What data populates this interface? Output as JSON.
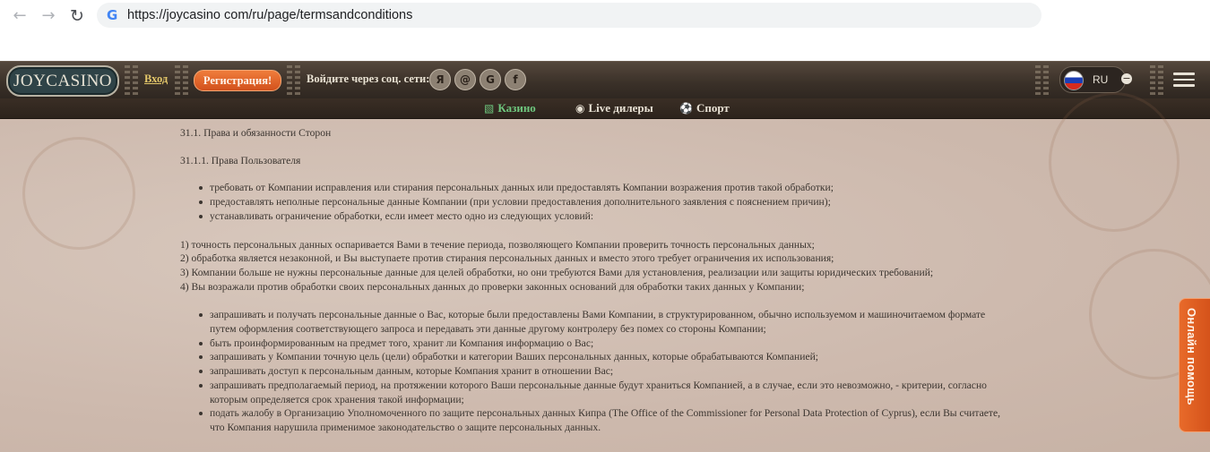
{
  "browser": {
    "url": "https://joycasino com/ru/page/termsandconditions",
    "back_icon": "arrow-left-icon",
    "forward_icon": "arrow-right-icon",
    "reload_icon": "reload-icon"
  },
  "header": {
    "logo": "JOYCASINO",
    "login_label": "Вход",
    "register_label": "Регистрация!",
    "social_label": "Войдите через соц. сети:",
    "socials": [
      {
        "glyph": "Я",
        "icon": "yandex-icon"
      },
      {
        "glyph": "@",
        "icon": "mailru-icon"
      },
      {
        "glyph": "G",
        "icon": "google-icon"
      },
      {
        "glyph": "f",
        "icon": "facebook-icon"
      }
    ],
    "language": "RU",
    "colors": {
      "accent": "#d2511c",
      "login": "#e4c76a",
      "active_tab": "#6ec77e"
    }
  },
  "subnav": {
    "items": [
      {
        "label": "Казино",
        "icon": "slot-machine-icon",
        "active": true
      },
      {
        "label": "Live дилеры",
        "icon": "dealer-icon",
        "active": false
      },
      {
        "label": "Спорт",
        "icon": "ball-icon",
        "active": false
      }
    ]
  },
  "terms": {
    "section_title": "31.1. Права и обязанности Сторон",
    "subsection_title": "31.1.1. Права Пользователя",
    "list_a": [
      "требовать от Компании исправления или стирания персональных данных или предоставлять Компании возражения против такой обработки;",
      "предоставлять неполные персональные данные Компании (при условии предоставления дополнительного заявления с пояснением причин);",
      "устанавливать ограничение обработки, если имеет место одно из следующих условий:"
    ],
    "numbered": [
      "1) точность персональных данных оспаривается Вами в течение периода, позволяющего Компании проверить точность персональных данных;",
      "2) обработка является незаконной, и Вы выступаете против стирания персональных данных и вместо этого требует ограничения их использования;",
      "3) Компании больше не нужны персональные данные для целей обработки, но они требуются Вами для установления, реализации или защиты юридических требований;",
      "4) Вы возражали против обработки своих персональных данных до проверки законных оснований для обработки таких данных у Компании;"
    ],
    "list_b": [
      "запрашивать и получать персональные данные о Вас, которые были предоставлены Вами Компании, в структурированном, обычно используемом и машиночитаемом формате путем оформления соответствующего запроса и передавать эти данные другому контролеру без помех со стороны Компании;",
      "быть проинформированным на предмет того, хранит ли Компания информацию о Вас;",
      "запрашивать у Компании точную цель (цели) обработки и категории Ваших персональных данных, которые обрабатываются Компанией;",
      "запрашивать доступ к персональным данным, которые Компания хранит в отношении Вас;",
      "запрашивать предполагаемый период, на протяжении которого Ваши персональные данные будут храниться Компанией, а в случае, если это невозможно, - критерии, согласно которым определяется срок хранения такой информации;",
      "подать жалобу в Организацию Уполномоченного по защите персональных данных Кипра (The Office of the Commissioner for Personal Data Protection of Cyprus), если Вы считаете, что Компания нарушила применимое законодательство о защите персональных данных."
    ]
  },
  "help_tab": {
    "label": "Онлайн помощь"
  }
}
